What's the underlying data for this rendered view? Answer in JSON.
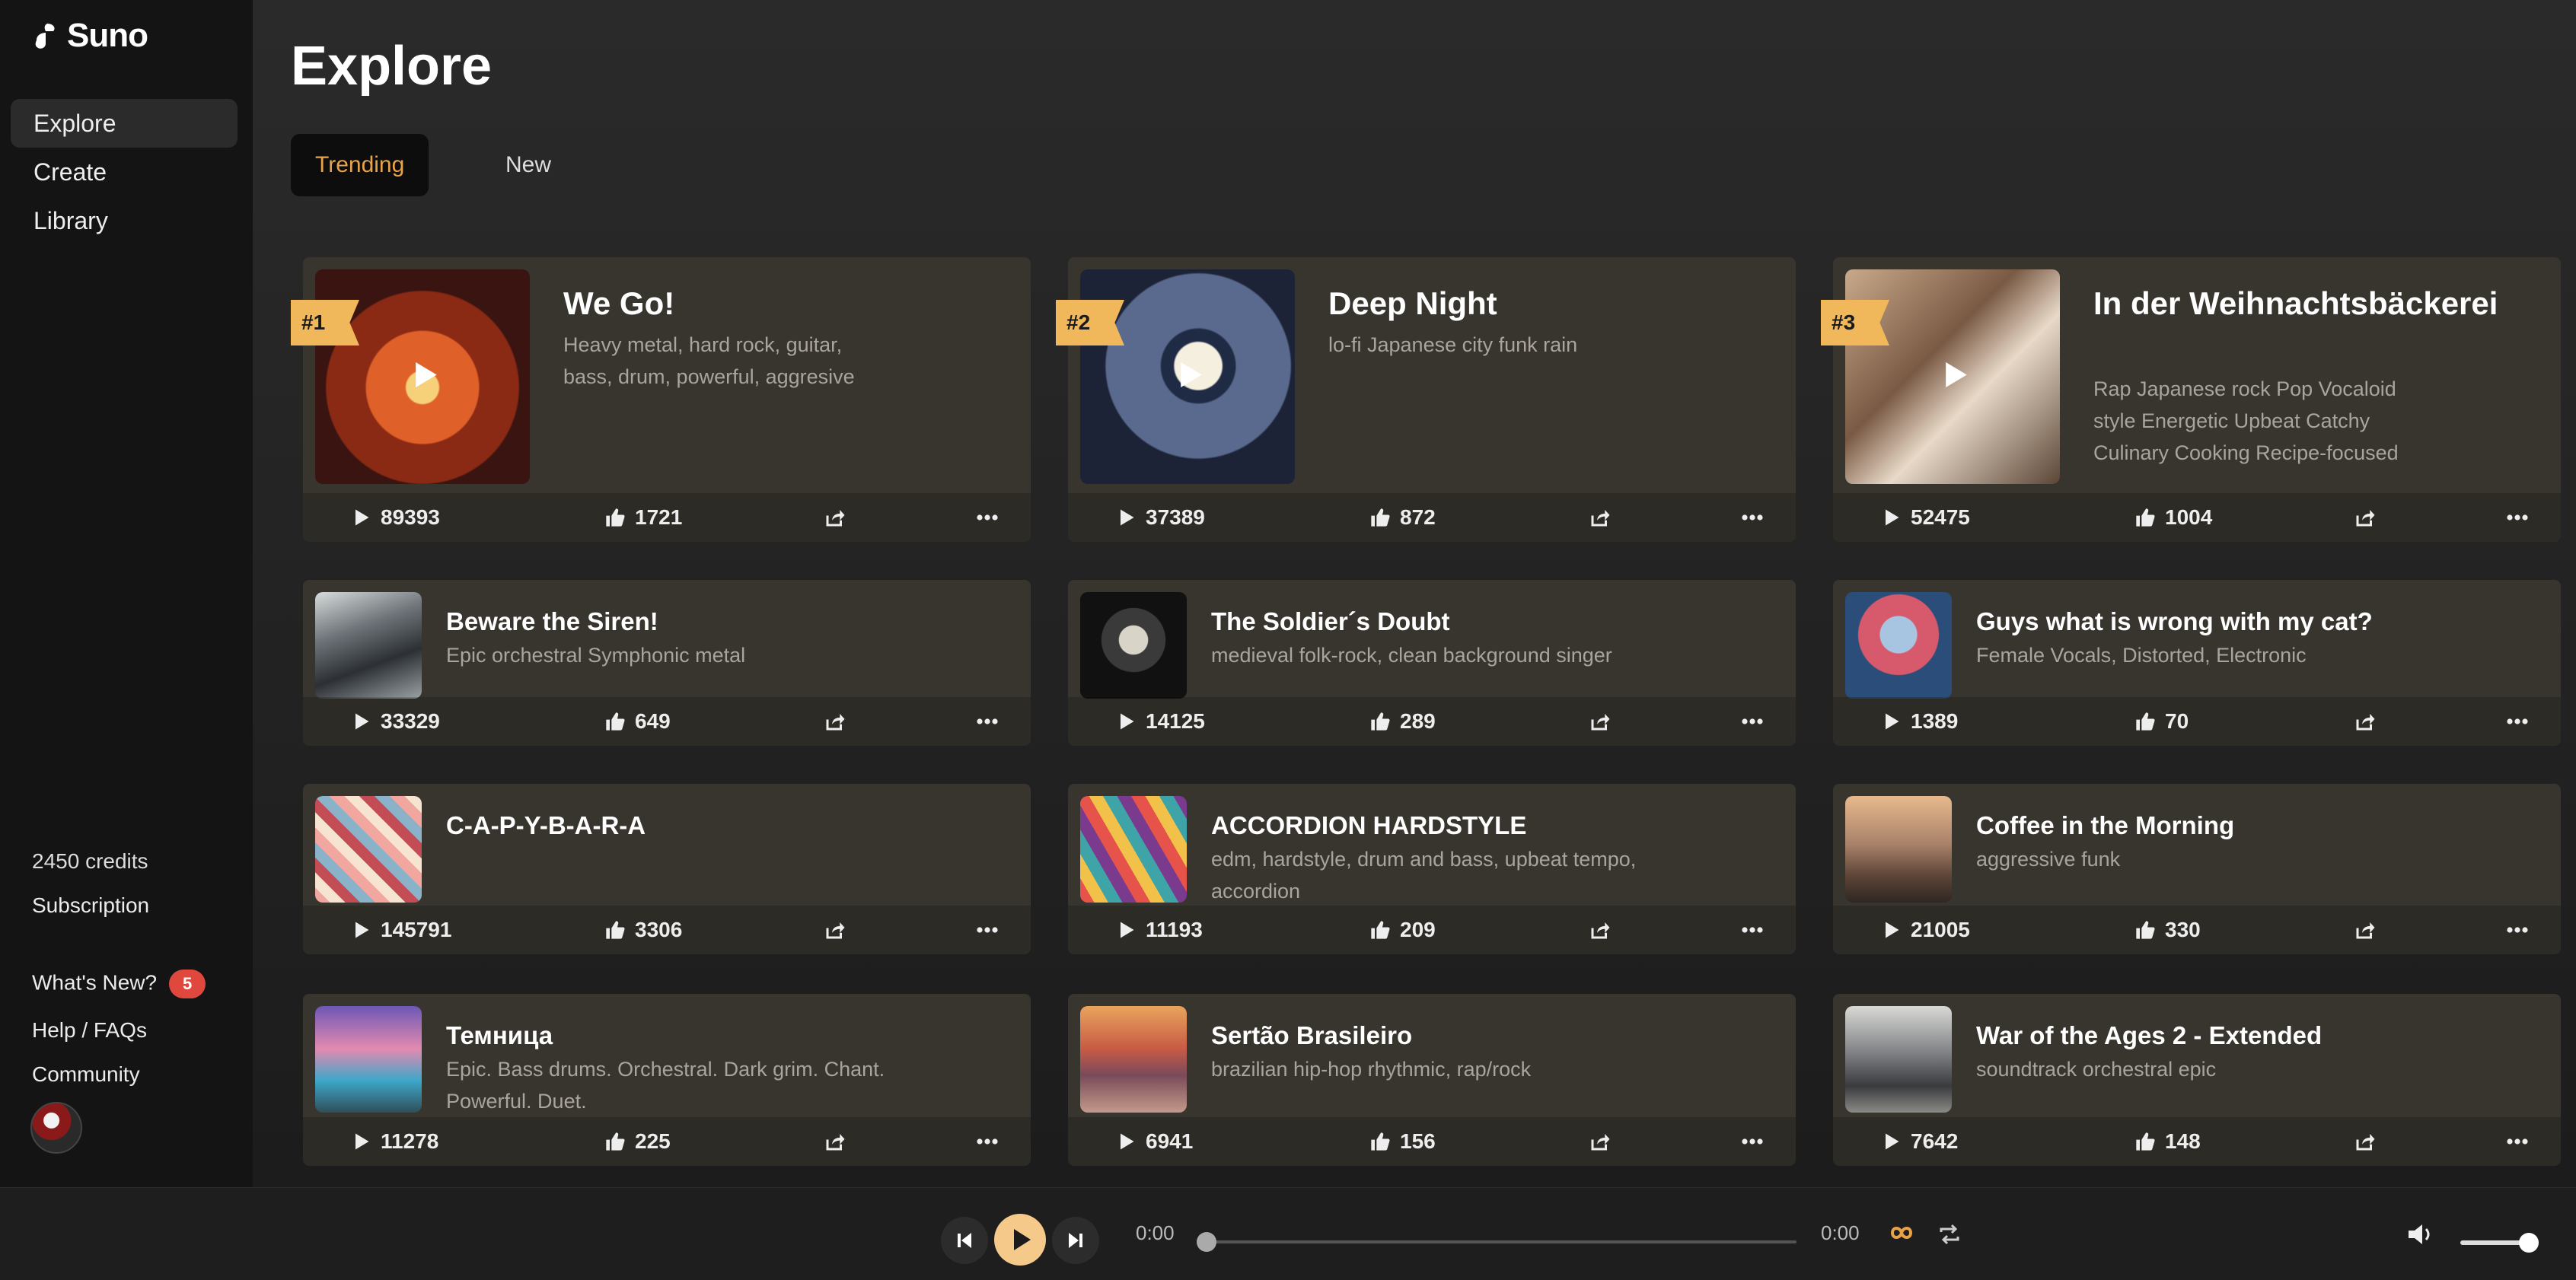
{
  "app": {
    "name": "Suno"
  },
  "sidebar": {
    "nav": [
      {
        "label": "Explore",
        "active": true
      },
      {
        "label": "Create",
        "active": false
      },
      {
        "label": "Library",
        "active": false
      }
    ],
    "credits": "2450 credits",
    "subscription": "Subscription",
    "whats_new": "What's New?",
    "whats_new_count": "5",
    "help": "Help / FAQs",
    "community": "Community"
  },
  "page": {
    "title": "Explore"
  },
  "tabs": [
    {
      "label": "Trending",
      "active": true
    },
    {
      "label": "New",
      "active": false
    }
  ],
  "featured": [
    {
      "rank": "#1",
      "title": "We Go!",
      "desc": "Heavy metal, hard rock, guitar, bass, drum, powerful, aggresive",
      "plays": "89393",
      "likes": "1721"
    },
    {
      "rank": "#2",
      "title": "Deep Night",
      "desc": "lo-fi Japanese city funk rain",
      "plays": "37389",
      "likes": "872"
    },
    {
      "rank": "#3",
      "title": "In der Weihnachtsbäckerei",
      "desc": "Rap Japanese rock Pop Vocaloid style Energetic Upbeat Catchy Culinary Cooking Recipe-focused",
      "plays": "52475",
      "likes": "1004"
    }
  ],
  "songs": [
    {
      "title": "Beware the Siren!",
      "desc": "Epic orchestral Symphonic metal",
      "plays": "33329",
      "likes": "649"
    },
    {
      "title": "The Soldier´s Doubt",
      "desc": "medieval folk-rock, clean background singer",
      "plays": "14125",
      "likes": "289"
    },
    {
      "title": "Guys what is wrong with my cat?",
      "desc": "Female Vocals, Distorted, Electronic",
      "plays": "1389",
      "likes": "70"
    },
    {
      "title": "C-A-P-Y-B-A-R-A",
      "desc": "",
      "plays": "145791",
      "likes": "3306"
    },
    {
      "title": "ACCORDION HARDSTYLE",
      "desc": "edm, hardstyle, drum and bass, upbeat tempo, accordion",
      "plays": "11193",
      "likes": "209"
    },
    {
      "title": "Coffee in the Morning",
      "desc": "aggressive funk",
      "plays": "21005",
      "likes": "330"
    },
    {
      "title": "Темница",
      "desc": "Epic. Bass drums. Orchestral. Dark grim. Chant. Powerful. Duet.",
      "plays": "11278",
      "likes": "225"
    },
    {
      "title": "Sertão Brasileiro",
      "desc": "brazilian hip-hop rhythmic, rap/rock",
      "plays": "6941",
      "likes": "156"
    },
    {
      "title": "War of the Ages 2 - Extended",
      "desc": "soundtrack orchestral epic",
      "plays": "7642",
      "likes": "148"
    }
  ],
  "player": {
    "current_time": "0:00",
    "duration": "0:00",
    "progress": 0,
    "volume": 0.9
  },
  "colors": {
    "accent": "#e8a24a",
    "rank_badge": "#f0b85a",
    "card_bg": "#38352f",
    "badge_red": "#e0483e"
  },
  "icons": {
    "play": "play-icon",
    "like": "thumbs-up-icon",
    "share": "share-icon",
    "more": "more-icon"
  }
}
